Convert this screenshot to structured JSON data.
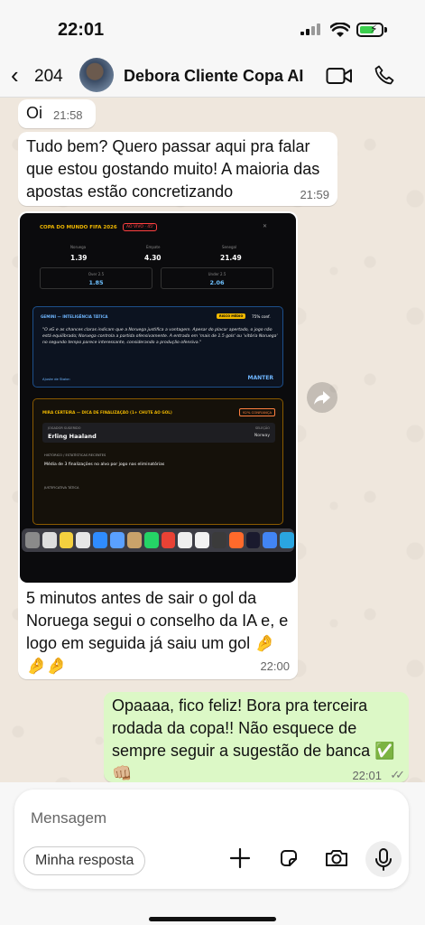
{
  "status_bar": {
    "time": "22:01"
  },
  "header": {
    "back_count": "204",
    "contact_name": "Debora Cliente Copa AI"
  },
  "messages": [
    {
      "direction": "in",
      "text": "Oi",
      "time": "21:58"
    },
    {
      "direction": "in",
      "text": "Tudo bem? Quero passar aqui pra falar que estou gostando muito! A maioria das apostas estão concretizando",
      "time": "21:59"
    },
    {
      "direction": "in",
      "text": "5 minutos antes de sair o gol da Noruega segui o conselho da IA e, e logo em seguida já saiu um gol 🤌🤌🤌",
      "time": "22:00"
    },
    {
      "direction": "out",
      "text": "Opaaaa, fico feliz! Bora pra terceira rodada da copa!! Não esquece de sempre seguir a sugestão de banca ✅👊🏼",
      "time": "22:01"
    }
  ],
  "screenshot": {
    "title": "COPA DO MUNDO FIFA 2026",
    "live_badge": "AO VIVO · 45'",
    "odds": [
      {
        "label": "Noruega",
        "value": "1.39"
      },
      {
        "label": "Empate",
        "value": "4.30"
      },
      {
        "label": "Senegal",
        "value": "21.49"
      }
    ],
    "totals": [
      {
        "label": "Over 2.5",
        "value": "1.85"
      },
      {
        "label": "Under 2.5",
        "value": "2.06"
      }
    ],
    "gemini": {
      "title": "GEMINI — INTELIGÊNCIA TÁTICA",
      "risk_badge": "RISCO MÉDIO",
      "confidence": "75% conf.",
      "body": "\"O xG e as chances claras indicam que a Noruega justifica a vantagem. Apesar do placar apertado, o jogo não está equilibrado; Noruega controla a partida ofensivamente. A entrada em 'mais de 1.5 gols' ou 'vitória Noruega' no segundo tempo parece interessante, considerando a produção ofensiva.\"",
      "footer": "Ajuste de Stake:",
      "action": "MANTER"
    },
    "mira": {
      "title": "MIRA CERTEIRA — DICA DE FINALIZAÇÃO (1+ CHUTE AO GOL)",
      "confidence": "92% CONFIANÇA",
      "player_label": "JOGADOR SUGERIDO",
      "player_name": "Erling Haaland",
      "selection_label": "SELEÇÃO",
      "selection_value": "Norway",
      "history_label": "HISTÓRICO / ESTATÍSTICAS RECENTES",
      "history_value": "Média de 3 finalizações no alvo por jogo nas eliminatórias",
      "justification_label": "JUSTIFICATIVA TÁTICA"
    }
  },
  "input": {
    "placeholder": "Mensagem",
    "reply_chip": "Minha resposta"
  },
  "colors": {
    "incoming_bubble": "#ffffff",
    "outgoing_bubble": "#dcf8c6",
    "background": "#efeae2"
  }
}
